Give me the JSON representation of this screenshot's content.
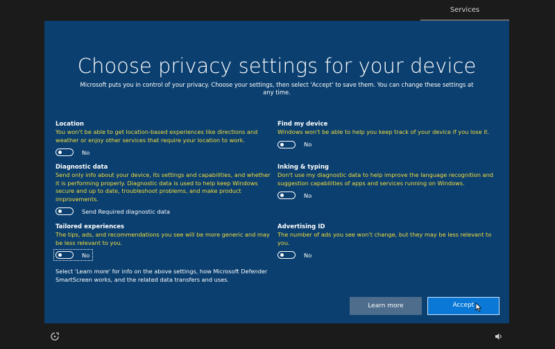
{
  "top_tab": {
    "label": "Services"
  },
  "title": "Choose privacy settings for your device",
  "subtitle": "Microsoft puts you in control of your privacy. Choose your settings, then select 'Accept' to save them. You can change these settings at any time.",
  "settings": [
    {
      "name": "Location",
      "desc": "You won't be able to get location-based experiences like directions and weather or enjoy other services that require your location to work.",
      "toggle_label": "No"
    },
    {
      "name": "Find my device",
      "desc": "Windows won't be able to help you keep track of your device if you lose it.",
      "toggle_label": "No"
    },
    {
      "name": "Diagnostic data",
      "desc": "Send only info about your device, its settings and capabilities, and whether it is performing properly. Diagnostic data is used to help keep Windows secure and up to date, troubleshoot problems, and make product improvements.",
      "toggle_label": "Send Required diagnostic data"
    },
    {
      "name": "Inking & typing",
      "desc": "Don't use my diagnostic data to help improve the language recognition and suggestion capabilities of apps and services running on Windows.",
      "toggle_label": "No"
    },
    {
      "name": "Tailored experiences",
      "desc": "The tips, ads, and recommendations you see will be more generic and may be less relevant to you.",
      "toggle_label": "No"
    },
    {
      "name": "Advertising ID",
      "desc": "The number of ads you see won't change, but they may be less relevant to you.",
      "toggle_label": "No"
    }
  ],
  "footnote": "Select 'Learn more' for info on the above settings, how Microsoft Defender SmartScreen works, and the related data transfers and uses.",
  "buttons": {
    "learn_more": "Learn more",
    "accept": "Accept"
  },
  "colors": {
    "panel": "#0b3f6f",
    "description": "#f4df3e",
    "accept": "#0a78d6",
    "learn_more": "#4e6c8c"
  },
  "icons": {
    "bottom_left": "ease-of-access-icon",
    "bottom_right": "volume-icon"
  }
}
